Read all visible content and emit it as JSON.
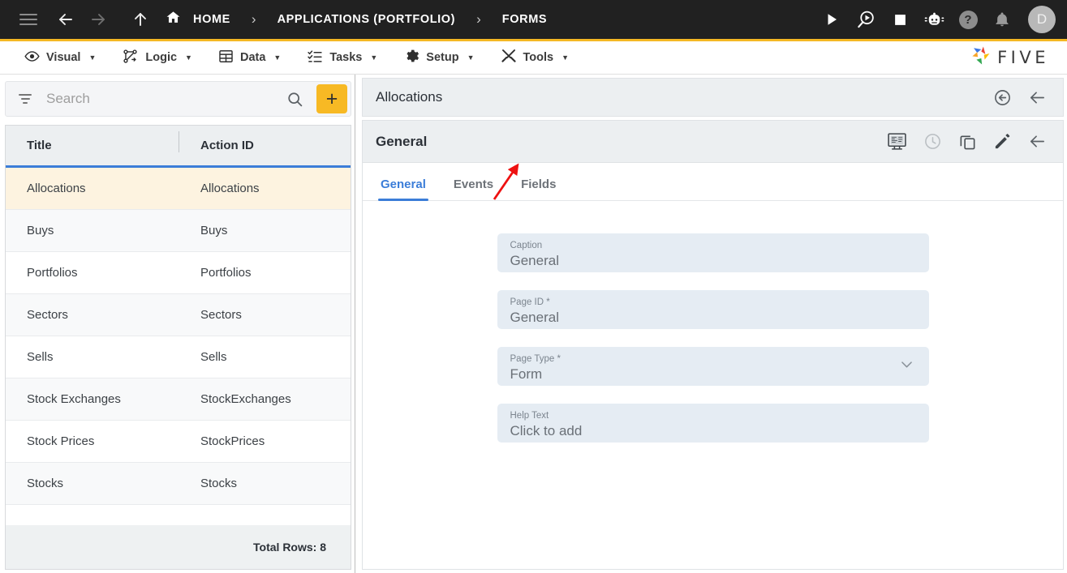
{
  "topbar": {
    "menu_icon": "hamburger-icon",
    "back_icon": "arrow-left-icon",
    "forward_icon": "arrow-right-icon",
    "up_icon": "arrow-up-icon",
    "breadcrumbs": [
      {
        "label": "HOME",
        "icon": "home-icon"
      },
      {
        "label": "APPLICATIONS (PORTFOLIO)",
        "icon": ""
      },
      {
        "label": "FORMS",
        "icon": ""
      }
    ],
    "separator": "›",
    "actions": [
      {
        "name": "run-icon",
        "label": "Run"
      },
      {
        "name": "debug-icon",
        "label": "Debug"
      },
      {
        "name": "stop-icon",
        "label": "Stop"
      },
      {
        "name": "bot-icon",
        "label": "Assistant"
      },
      {
        "name": "help-icon",
        "label": "?"
      },
      {
        "name": "notifications-bell-icon",
        "label": "Notifications"
      }
    ],
    "avatar_initial": "D"
  },
  "menubar": {
    "items": [
      {
        "label": "Visual",
        "icon": "eye-icon",
        "caret": "▼"
      },
      {
        "label": "Logic",
        "icon": "logic-graph-icon",
        "caret": "▼"
      },
      {
        "label": "Data",
        "icon": "table-icon",
        "caret": "▼"
      },
      {
        "label": "Tasks",
        "icon": "checklist-icon",
        "caret": "▼"
      },
      {
        "label": "Setup",
        "icon": "gear-icon",
        "caret": "▼"
      },
      {
        "label": "Tools",
        "icon": "tools-icon",
        "caret": "▼"
      }
    ],
    "brand": "FIVE",
    "brand_accent": "#f5b824"
  },
  "left_panel": {
    "search": {
      "placeholder": "Search",
      "value": "",
      "filter_icon": "filter-icon",
      "search_icon": "search-icon"
    },
    "add_button": {
      "label": "+",
      "color": "#f7b924"
    },
    "columns": [
      "Title",
      "Action ID"
    ],
    "rows": [
      {
        "title": "Allocations",
        "action_id": "Allocations",
        "selected": true
      },
      {
        "title": "Buys",
        "action_id": "Buys",
        "selected": false
      },
      {
        "title": "Portfolios",
        "action_id": "Portfolios",
        "selected": false
      },
      {
        "title": "Sectors",
        "action_id": "Sectors",
        "selected": false
      },
      {
        "title": "Sells",
        "action_id": "Sells",
        "selected": false
      },
      {
        "title": "Stock Exchanges",
        "action_id": "StockExchanges",
        "selected": false
      },
      {
        "title": "Stock Prices",
        "action_id": "StockPrices",
        "selected": false
      },
      {
        "title": "Stocks",
        "action_id": "Stocks",
        "selected": false
      }
    ],
    "footer": "Total Rows: 8"
  },
  "right_panel": {
    "header": {
      "title": "Allocations",
      "actions": [
        {
          "name": "revert-circle-arrow-icon"
        },
        {
          "name": "back-arrow-icon"
        }
      ]
    },
    "card": {
      "title": "General",
      "actions": [
        {
          "name": "preview-monitor-icon"
        },
        {
          "name": "history-clock-icon"
        },
        {
          "name": "duplicate-copy-icon"
        },
        {
          "name": "edit-pencil-icon"
        },
        {
          "name": "back-arrow-icon"
        }
      ],
      "tabs": [
        {
          "label": "General",
          "active": true
        },
        {
          "label": "Events",
          "active": false
        },
        {
          "label": "Fields",
          "active": false
        }
      ],
      "fields": [
        {
          "label": "Caption",
          "value": "General",
          "type": "text"
        },
        {
          "label": "Page ID *",
          "value": "General",
          "type": "text"
        },
        {
          "label": "Page Type *",
          "value": "Form",
          "type": "select"
        },
        {
          "label": "Help Text",
          "value": "Click to add",
          "type": "text"
        }
      ]
    }
  },
  "annotation": {
    "color": "#ee1111",
    "points_to": "Fields"
  },
  "theme": {
    "accent_blue": "#3b7dd8",
    "accent_yellow": "#f5b824",
    "selected_row": "#fdf3e0",
    "header_gray": "#eceff1",
    "field_bg": "#e5ecf3"
  }
}
